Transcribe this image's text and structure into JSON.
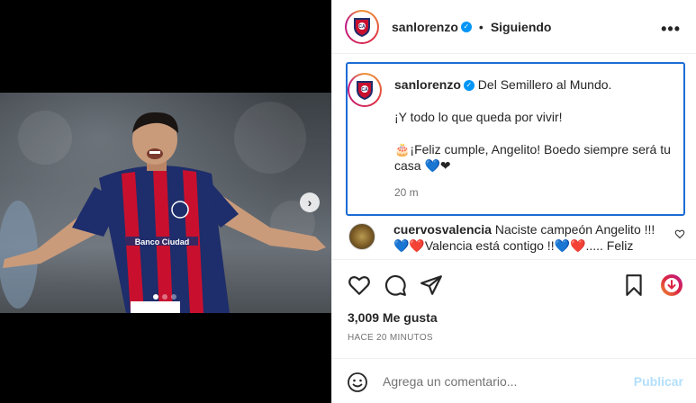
{
  "post": {
    "carousel": {
      "slide_count": 3,
      "active_index": 0
    }
  },
  "header": {
    "username": "sanlorenzo",
    "separator": "•",
    "follow_status": "Siguiendo",
    "more_icon": "more-horizontal-icon"
  },
  "caption": {
    "username": "sanlorenzo",
    "line1": "Del Semillero al Mundo.",
    "line2": "¡Y todo lo que queda por vivir!",
    "line3": "🎂¡Feliz cumple, Angelito! Boedo siempre será tu casa 💙❤",
    "time": "20 m"
  },
  "comments": [
    {
      "username": "cuervosvalencia",
      "text": "Naciste campeón Angelito !!! 💙❤️Valencia está contigo !!💙❤️..... Feliz"
    }
  ],
  "actions": {
    "like_icon": "heart-icon",
    "comment_icon": "comment-icon",
    "share_icon": "send-icon",
    "save_icon": "bookmark-icon"
  },
  "likes_text": "3,009 Me gusta",
  "time_ago": "HACE 20 MINUTOS",
  "add_comment": {
    "placeholder": "Agrega un comentario...",
    "publish_label": "Publicar"
  },
  "colors": {
    "accent": "#0095f6",
    "focus_border": "#1c6cd4",
    "jersey_blue": "#1e2d6b",
    "jersey_red": "#c8102e"
  }
}
